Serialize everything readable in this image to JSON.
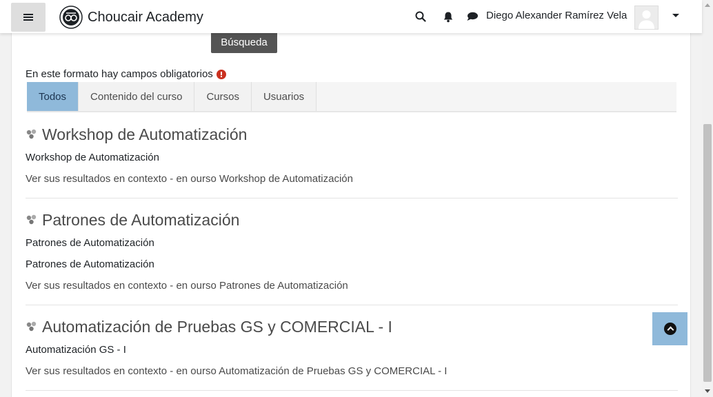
{
  "navbar": {
    "brand_name": "Choucair Academy",
    "user_name": "Diego Alexander Ramírez Vela",
    "icons": [
      "hamburger-menu-icon",
      "search-icon",
      "bell-icon",
      "chat-bubble-icon",
      "user-avatar-icon",
      "caret-down-icon"
    ]
  },
  "search": {
    "button_label": "Búsqueda"
  },
  "form": {
    "required_note": "En este formato hay campos obligatorios"
  },
  "tabs": [
    {
      "label": "Todos",
      "active": true
    },
    {
      "label": "Contenido del curso",
      "active": false
    },
    {
      "label": "Cursos",
      "active": false
    },
    {
      "label": "Usuarios",
      "active": false
    }
  ],
  "results": [
    {
      "title": "Workshop de Automatización",
      "lines": [
        "Workshop de Automatización"
      ],
      "context": "Ver sus resultados en contexto - en ourso Workshop de Automatización"
    },
    {
      "title": "Patrones de Automatización",
      "lines": [
        "Patrones de Automatización",
        "Patrones de Automatización"
      ],
      "context": "Ver sus resultados en contexto - en ourso Patrones de Automatización"
    },
    {
      "title": "Automatización de Pruebas GS y COMERCIAL - I",
      "lines": [
        "Automatización GS - I"
      ],
      "context": "Ver sus resultados en contexto - en ourso Automatización de Pruebas GS y COMERCIAL - I"
    }
  ],
  "colors": {
    "active_tab": "#8fb9da",
    "search_button": "#545454",
    "required_icon": "#ca3120"
  }
}
